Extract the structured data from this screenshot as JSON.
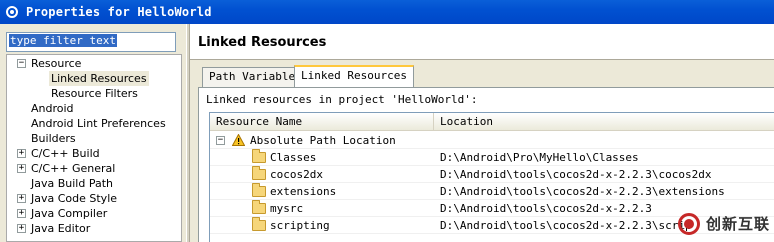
{
  "window": {
    "title": "Properties for HelloWorld"
  },
  "filter": {
    "value": "type filter text"
  },
  "tree": {
    "items": [
      {
        "label": "Resource"
      },
      {
        "label": "Linked Resources"
      },
      {
        "label": "Resource Filters"
      },
      {
        "label": "Android"
      },
      {
        "label": "Android Lint Preferences"
      },
      {
        "label": "Builders"
      },
      {
        "label": "C/C++ Build"
      },
      {
        "label": "C/C++ General"
      },
      {
        "label": "Java Build Path"
      },
      {
        "label": "Java Code Style"
      },
      {
        "label": "Java Compiler"
      },
      {
        "label": "Java Editor"
      }
    ]
  },
  "page": {
    "heading": "Linked Resources"
  },
  "tabs": [
    {
      "label": "Path Variables"
    },
    {
      "label": "Linked Resources"
    }
  ],
  "pane": {
    "description": "Linked resources in project 'HelloWorld':"
  },
  "table": {
    "columns": [
      "Resource Name",
      "Location"
    ],
    "group": "Absolute Path Location",
    "rows": [
      {
        "name": "Classes",
        "location": "D:\\Android\\Pro\\MyHello\\Classes"
      },
      {
        "name": "cocos2dx",
        "location": "D:\\Android\\tools\\cocos2d-x-2.2.3\\cocos2dx"
      },
      {
        "name": "extensions",
        "location": "D:\\Android\\tools\\cocos2d-x-2.2.3\\extensions"
      },
      {
        "name": "mysrc",
        "location": "D:\\Android\\tools\\cocos2d-x-2.2.3"
      },
      {
        "name": "scripting",
        "location": "D:\\Android\\tools\\cocos2d-x-2.2.3\\scrip"
      }
    ]
  },
  "watermark": {
    "text": "创新互联"
  }
}
